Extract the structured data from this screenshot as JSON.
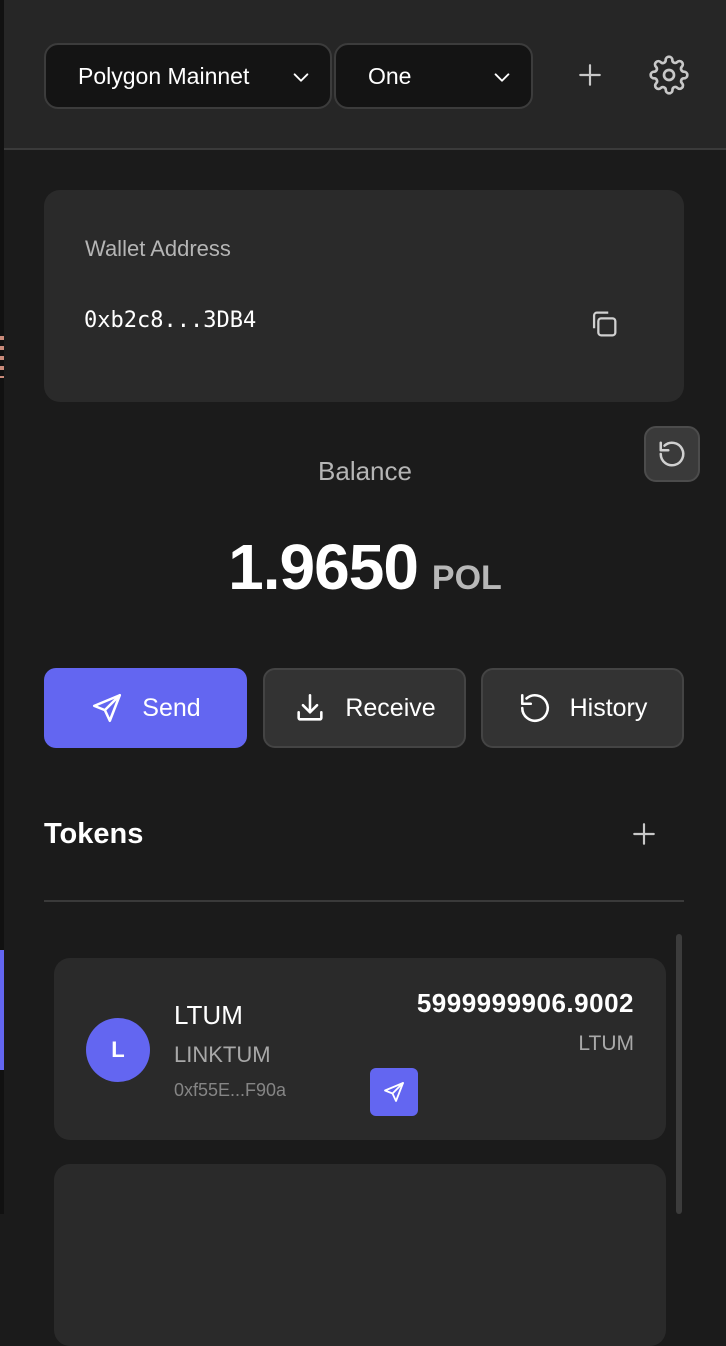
{
  "header": {
    "network": "Polygon Mainnet",
    "account": "One",
    "icons": {
      "add": "plus-icon",
      "settings": "gear-icon",
      "dropdown": "chevron-down-icon"
    }
  },
  "wallet": {
    "label": "Wallet Address",
    "address": "0xb2c8...3DB4",
    "copy_icon": "copy-icon",
    "refresh_icon": "refresh-icon"
  },
  "balance": {
    "label": "Balance",
    "value": "1.9650",
    "unit": "POL"
  },
  "actions": {
    "send": "Send",
    "receive": "Receive",
    "history": "History"
  },
  "tokens": {
    "title": "Tokens",
    "items": [
      {
        "initial": "L",
        "symbol": "LTUM",
        "name": "LINKTUM",
        "address": "0xf55E...F90a",
        "amount": "5999999906.9002",
        "unit": "LTUM"
      }
    ]
  },
  "colors": {
    "accent": "#6366f1",
    "background": "#1b1b1b",
    "card": "#2a2a2a",
    "header": "#262626"
  }
}
